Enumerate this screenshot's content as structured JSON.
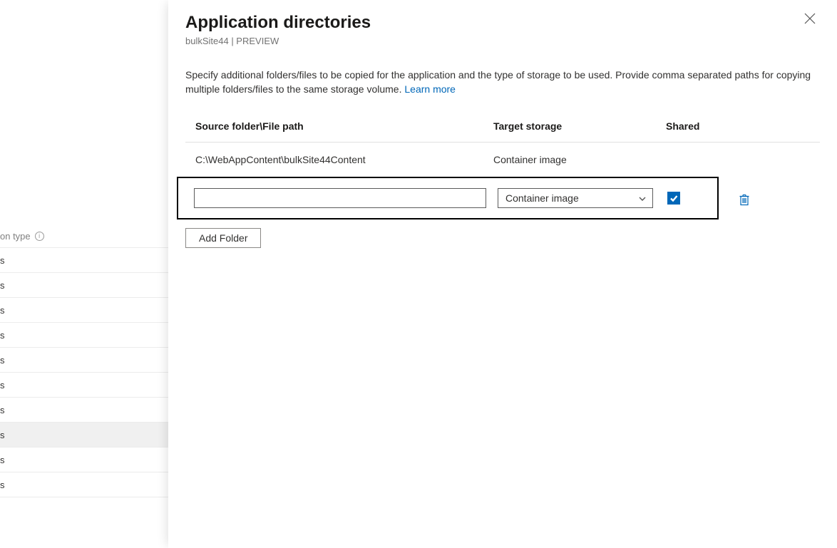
{
  "background": {
    "label_partial": "on type",
    "rows": [
      {
        "text": "s",
        "selected": false
      },
      {
        "text": "s",
        "selected": false
      },
      {
        "text": "s",
        "selected": false
      },
      {
        "text": "s",
        "selected": false
      },
      {
        "text": "s",
        "selected": false
      },
      {
        "text": "s",
        "selected": false
      },
      {
        "text": "s",
        "selected": false
      },
      {
        "text": "s",
        "selected": true
      },
      {
        "text": "s",
        "selected": false
      },
      {
        "text": "s",
        "selected": false
      }
    ]
  },
  "panel": {
    "title": "Application directories",
    "subtitle": "bulkSite44 | PREVIEW",
    "description": "Specify additional folders/files to be copied for the application and the type of storage to be used. Provide comma separated paths for copying multiple folders/files to the same storage volume. ",
    "learn_more": "Learn more",
    "columns": {
      "source": "Source folder\\File path",
      "target": "Target storage",
      "shared": "Shared"
    },
    "existing_row": {
      "source": "C:\\WebAppContent\\bulkSite44Content",
      "target": "Container image"
    },
    "input_row": {
      "source_value": "",
      "target_selected": "Container image",
      "shared_checked": true
    },
    "add_folder_label": "Add Folder",
    "icons": {
      "close": "close-icon",
      "chevron": "chevron-down-icon",
      "check": "check-icon",
      "trash": "trash-icon",
      "info": "info-icon"
    },
    "colors": {
      "link": "#0067b8",
      "checkbox_bg": "#0067b8",
      "border": "#5b5b5b"
    }
  }
}
